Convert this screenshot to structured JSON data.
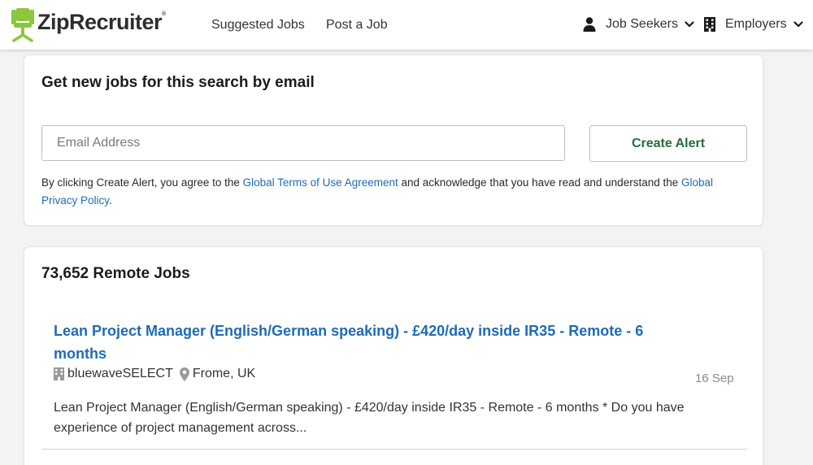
{
  "header": {
    "logo_text": "ZipRecruiter",
    "logo_reg": "®",
    "nav": {
      "suggested_jobs": "Suggested Jobs",
      "post_a_job": "Post a Job",
      "job_seekers": "Job Seekers",
      "employers": "Employers"
    }
  },
  "alert": {
    "title": "Get new jobs for this search by email",
    "email_placeholder": "Email Address",
    "email_value": "",
    "button_label": "Create Alert",
    "disclaimer_pre": "By clicking Create Alert, you agree to the ",
    "terms_link": "Global Terms of Use Agreement",
    "disclaimer_mid": " and acknowledge that you have read and understand the ",
    "privacy_link": "Global Privacy Policy",
    "disclaimer_post": "."
  },
  "results": {
    "title": "73,652 Remote Jobs",
    "jobs": [
      {
        "title": "Lean Project Manager (English/German speaking) - £420/day inside IR35 - Remote - 6 months",
        "company": "bluewaveSELECT",
        "location": "Frome, UK",
        "posted": "16 Sep",
        "snippet": "Lean Project Manager (English/German speaking) - £420/day inside IR35 - Remote - 6 months * Do you have experience of project management across..."
      }
    ]
  },
  "colors": {
    "brand_green": "#8cc63f",
    "link_blue": "#1e6bb8",
    "button_text_green": "#2b6a3c"
  },
  "icons": {
    "logo": "chair-logo-icon",
    "job_seekers": "person-icon",
    "employers": "building-icon",
    "dropdown": "chevron-down-icon",
    "company": "building-icon",
    "location": "map-pin-icon"
  }
}
